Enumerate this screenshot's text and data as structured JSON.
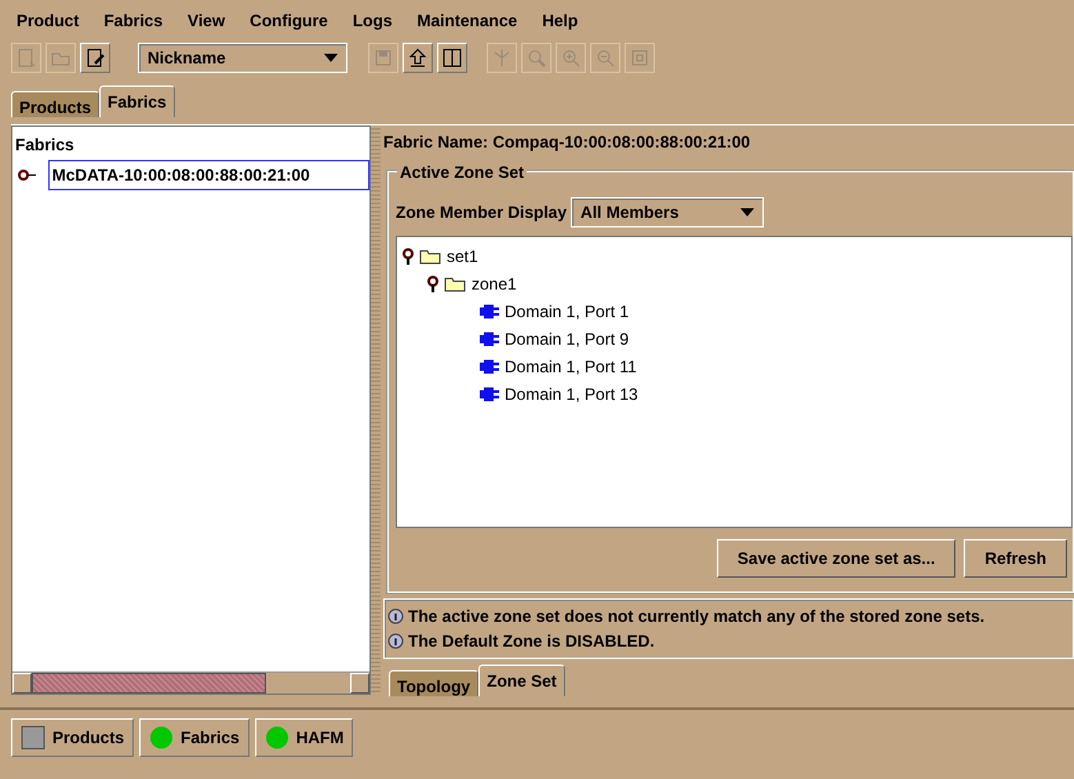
{
  "menu": [
    "Product",
    "Fabrics",
    "View",
    "Configure",
    "Logs",
    "Maintenance",
    "Help"
  ],
  "toolbar": [
    {
      "kind": "new",
      "disabled": true
    },
    {
      "kind": "open",
      "disabled": true
    },
    {
      "kind": "edit",
      "disabled": false
    },
    {
      "kind": "combo",
      "value": "Nickname"
    },
    {
      "kind": "save",
      "disabled": true
    },
    {
      "kind": "upload",
      "disabled": false
    },
    {
      "kind": "zl",
      "disabled": false
    },
    {
      "kind": "topology",
      "disabled": true
    },
    {
      "kind": "zoom",
      "disabled": true
    },
    {
      "kind": "zoom-in",
      "disabled": true
    },
    {
      "kind": "zoom-out",
      "disabled": true
    },
    {
      "kind": "fit",
      "disabled": true
    }
  ],
  "tabs": [
    {
      "label": "Products",
      "selected": false
    },
    {
      "label": "Fabrics",
      "selected": true
    }
  ],
  "left_panel": {
    "title": "Fabrics",
    "items": [
      {
        "label": "McDATA-10:00:08:00:88:00:21:00",
        "selected": true
      }
    ]
  },
  "right_panel": {
    "fabric_name": "Fabric Name: Compaq-10:00:08:00:88:00:21:00",
    "group_title": "Active Zone Set",
    "display_label": "Zone Member Display",
    "display_value": "All Members",
    "tree": [
      {
        "label": "set1",
        "kind": "folder",
        "expanded": true,
        "children": [
          {
            "label": "zone1",
            "kind": "folder",
            "expanded": true,
            "children": [
              {
                "label": "Domain 1, Port 1",
                "kind": "port"
              },
              {
                "label": "Domain 1, Port 9",
                "kind": "port"
              },
              {
                "label": "Domain 1, Port 11",
                "kind": "port"
              },
              {
                "label": "Domain 1, Port 13",
                "kind": "port"
              }
            ]
          }
        ]
      }
    ],
    "buttons": [
      "Save active zone set as...",
      "Refresh"
    ],
    "messages": [
      "The active zone set does not currently match any of the stored zone sets.",
      "The Default Zone is DISABLED."
    ],
    "tabs": [
      {
        "label": "Topology",
        "selected": false
      },
      {
        "label": "Zone Set",
        "selected": true
      }
    ]
  },
  "status_bar": [
    {
      "label": "Products",
      "kind": "square",
      "color": "#999999"
    },
    {
      "label": "Fabrics",
      "kind": "circle",
      "color": "#00c800"
    },
    {
      "label": "HAFM",
      "kind": "circle",
      "color": "#00c800"
    }
  ]
}
